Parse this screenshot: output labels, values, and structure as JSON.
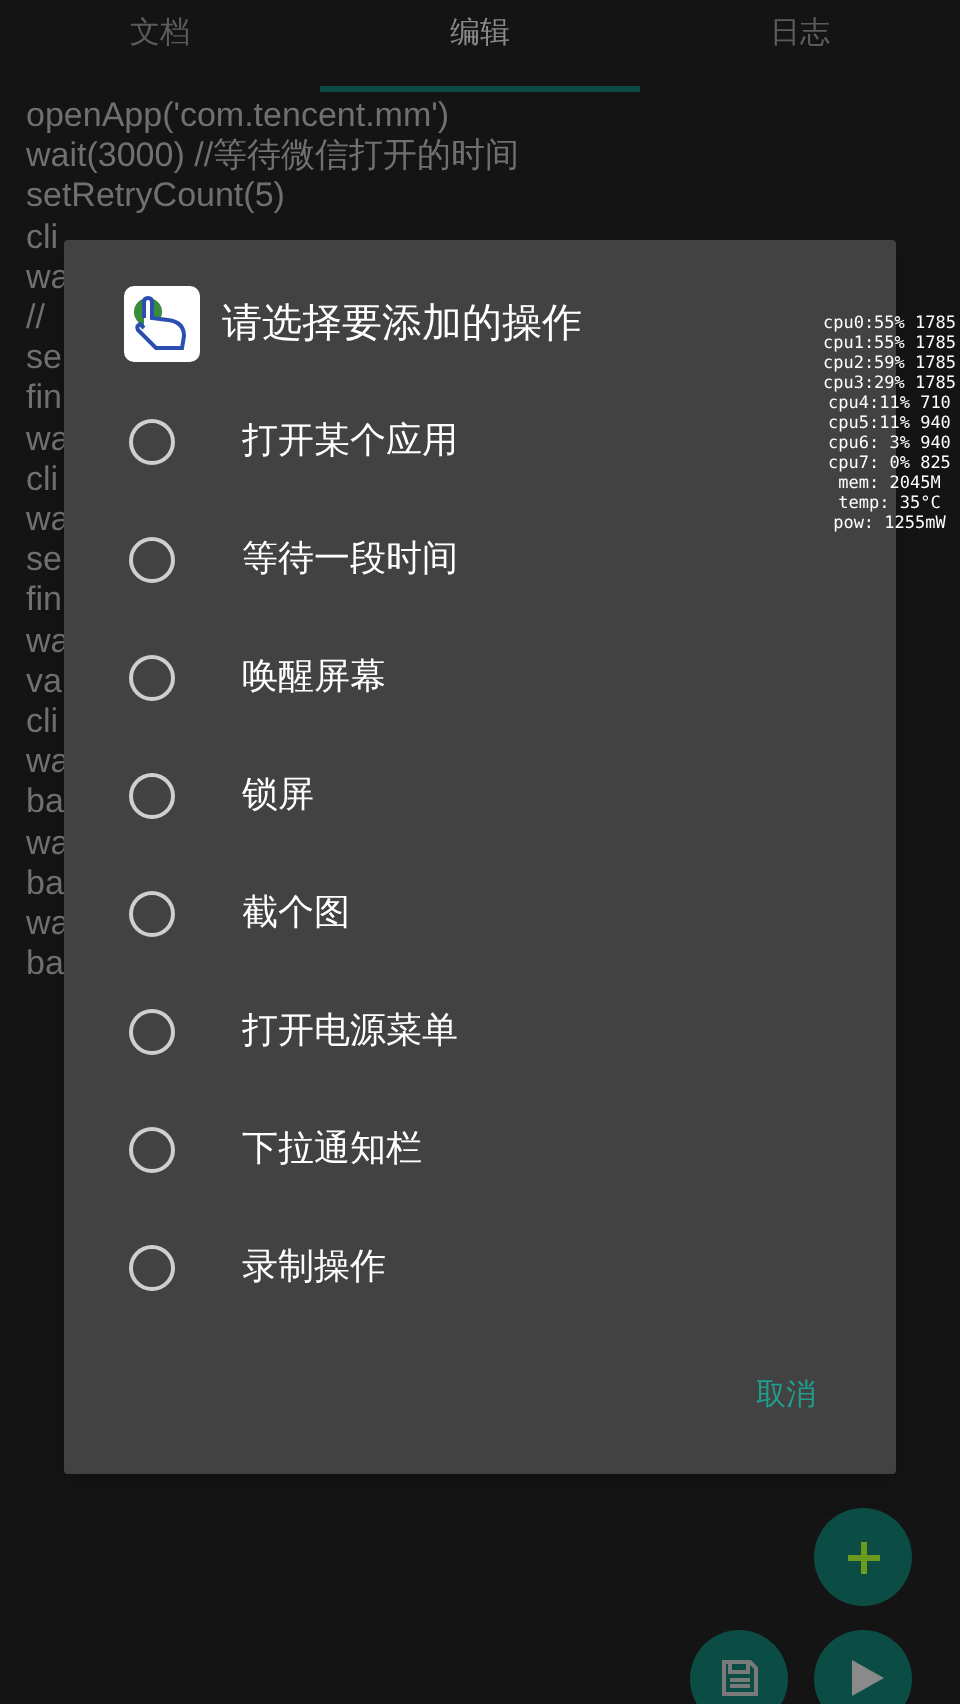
{
  "tabs": [
    {
      "label": "文档",
      "selected": false
    },
    {
      "label": "编辑",
      "selected": true
    },
    {
      "label": "日志",
      "selected": false
    }
  ],
  "code_lines": [
    "openApp('com.tencent.mm')",
    "wait(3000) //等待微信打开的时间",
    "setRetryCount(5)",
    "cli",
    "wa",
    "//",
    "se",
    "fin",
    "wa",
    "cli",
    "wa",
    "se",
    "fin",
    "wa",
    "va",
    "cli",
    "wa",
    "ba",
    "wa",
    "ba",
    "wa",
    "ba"
  ],
  "dialog": {
    "title": "请选择要添加的操作",
    "options": [
      {
        "label": "打开某个应用",
        "selected": false
      },
      {
        "label": "等待一段时间",
        "selected": false
      },
      {
        "label": "唤醒屏幕",
        "selected": false
      },
      {
        "label": "锁屏",
        "selected": false
      },
      {
        "label": "截个图",
        "selected": false
      },
      {
        "label": "打开电源菜单",
        "selected": false
      },
      {
        "label": "下拉通知栏",
        "selected": false
      },
      {
        "label": "录制操作",
        "selected": false
      }
    ],
    "cancel": "取消"
  },
  "perf_overlay": [
    "cpu0:55% 1785",
    "cpu1:55% 1785",
    "cpu2:59% 1785",
    "cpu3:29% 1785",
    "cpu4:11% 710",
    "cpu5:11% 940",
    "cpu6: 3% 940",
    "cpu7: 0% 825",
    "mem: 2045M",
    "temp: 35°C",
    "pow: 1255mW"
  ]
}
